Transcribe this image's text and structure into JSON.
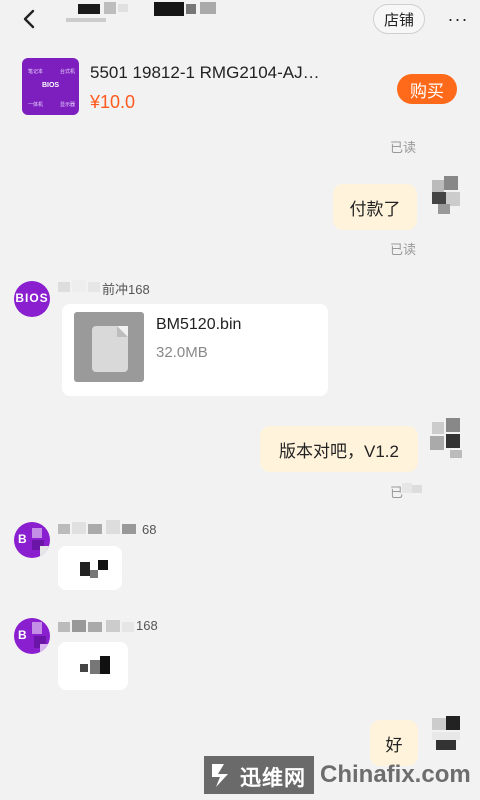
{
  "header": {
    "store_label": "店铺",
    "more_label": "···"
  },
  "product": {
    "name": "5501 19812-1 RMG2104-AJ…",
    "price": "¥10.0",
    "thumb_text": "BIOS",
    "thumb_labels": [
      "笔记本",
      "台式机",
      "一体机",
      "显示器"
    ],
    "buy_label": "购买"
  },
  "messages": {
    "read_1": "已读",
    "me_1": "付款了",
    "read_2": "已读",
    "sender_1": "前冲168",
    "avatar_text": "BIOS",
    "file_name": "BM5120.bin",
    "file_size": "32.0MB",
    "me_2": "版本对吧，V1.2",
    "read_3": "已",
    "sender_2": "68",
    "sender_3": "168",
    "me_3": "好"
  },
  "watermark": {
    "cn": "迅维网",
    "en": "Chinafix.com"
  },
  "colors": {
    "accent_orange": "#ff6a1a",
    "price": "#ff5a1f",
    "my_bubble": "#fff3dc",
    "avatar_purple": "#8a1fcf"
  }
}
